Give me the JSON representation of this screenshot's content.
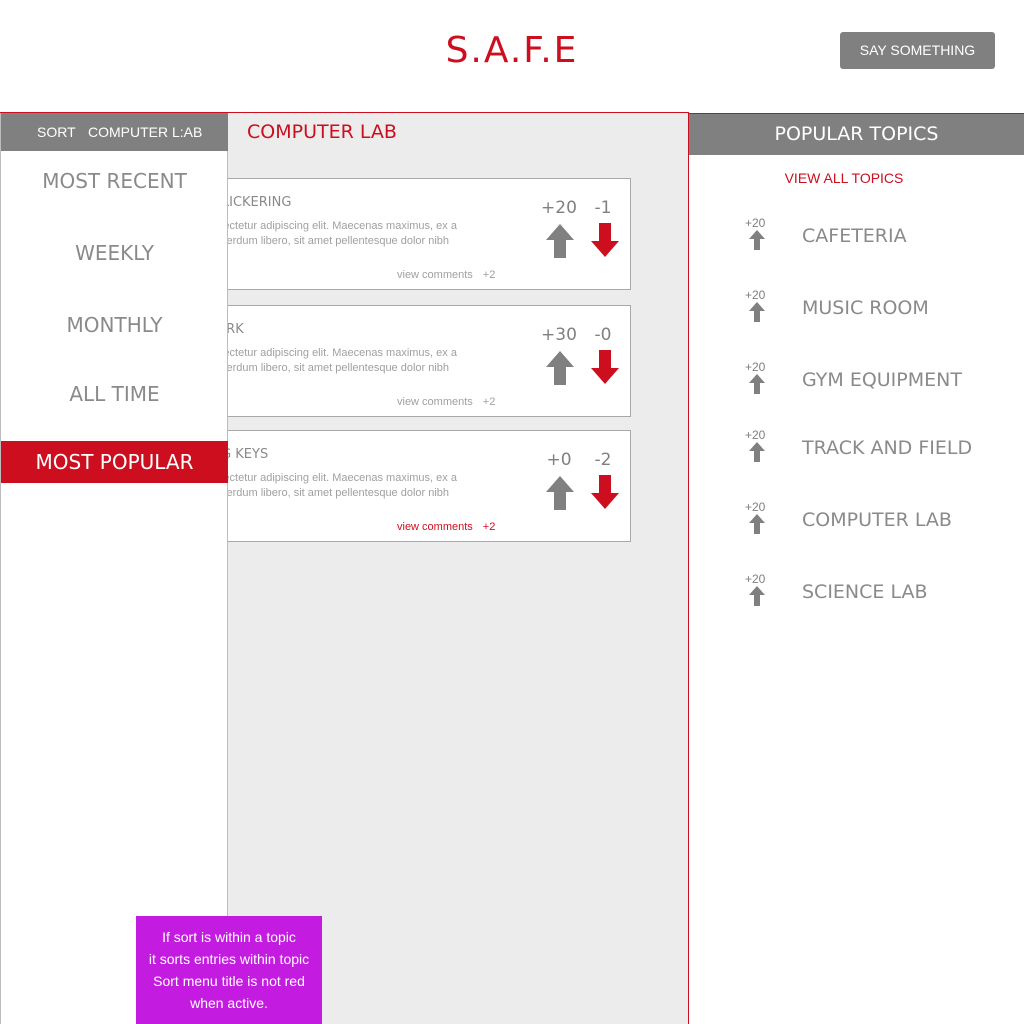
{
  "app": {
    "logo": "S.A.F.E",
    "say_button": "SAY SOMETHING"
  },
  "colors": {
    "accent": "#cc0e1f",
    "header_gray": "#808080",
    "main_bg": "#ececec",
    "note_bg": "#c31be0"
  },
  "sort": {
    "label": "SORT",
    "topic": "COMPUTER L:AB",
    "items": [
      {
        "label": "MOST RECENT",
        "active": false
      },
      {
        "label": "WEEKLY",
        "active": false
      },
      {
        "label": "MONTHLY",
        "active": false
      },
      {
        "label": "ALL TIME",
        "active": false
      },
      {
        "label": "MOST POPULAR",
        "active": true
      }
    ]
  },
  "main": {
    "title": "COMPUTER LAB",
    "posts": [
      {
        "title": "OR FLICKERING",
        "body_line1": "t, consectetur adipiscing elit. Maecenas maximus, ex a",
        "body_line2": "pien interdum libero, sit amet pellentesque dolor nibh",
        "comments_label": "view comments",
        "comments_count": "+2",
        "up": "+20",
        "down": "-1",
        "comments_active": false
      },
      {
        "title": "T WORK",
        "body_line1": "t, consectetur adipiscing elit. Maecenas maximus, ex a",
        "body_line2": "pien interdum libero, sit amet pellentesque dolor nibh",
        "comments_label": "view comments",
        "comments_count": "+2",
        "up": "+30",
        "down": "-0",
        "comments_active": false
      },
      {
        "title": "SSING KEYS",
        "body_line1": "t, consectetur adipiscing elit. Maecenas maximus, ex a",
        "body_line2": "pien interdum libero, sit amet pellentesque dolor nibh",
        "comments_label": "view comments",
        "comments_count": "+2",
        "up": "+0",
        "down": "-2",
        "comments_active": true
      }
    ]
  },
  "popular": {
    "title": "POPULAR TOPICS",
    "view_all": "VIEW ALL TOPICS",
    "topics": [
      {
        "count": "+20",
        "name": "CAFETERIA"
      },
      {
        "count": "+20",
        "name": "MUSIC ROOM"
      },
      {
        "count": "+20",
        "name": "GYM EQUIPMENT"
      },
      {
        "count": "+20",
        "name": "TRACK AND FIELD"
      },
      {
        "count": "+20",
        "name": "COMPUTER LAB"
      },
      {
        "count": "+20",
        "name": "SCIENCE LAB"
      }
    ]
  },
  "note": {
    "line1": "If sort is within a topic",
    "line2": "it sorts entries within topic",
    "line3": "Sort menu title is not red",
    "line4": "when active."
  }
}
